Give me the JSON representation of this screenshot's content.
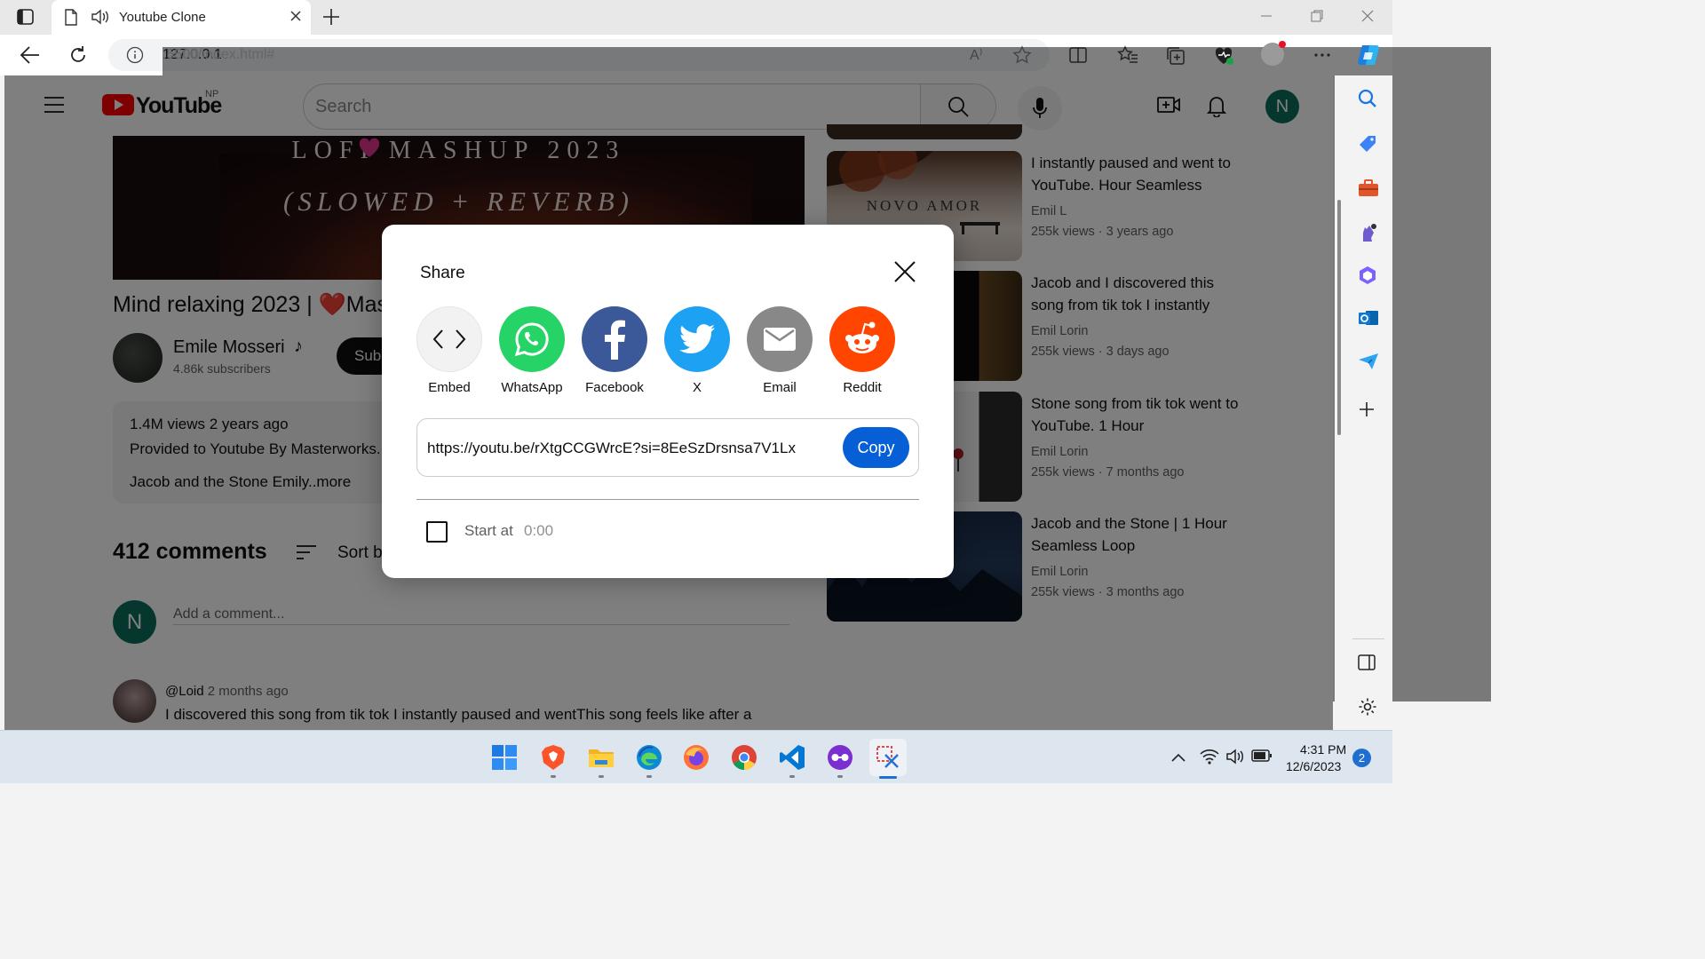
{
  "browser": {
    "tab_title": "Youtube Clone",
    "url_host": "127.0.0.1",
    "url_rest": ":5500/index.html#",
    "read_aloud": "A⁾"
  },
  "header": {
    "logo_text": "YouTube",
    "region": "NP",
    "search_placeholder": "Search",
    "avatar_letter": "N"
  },
  "video": {
    "thumb_line1": "LOFI    MASHUP 2023",
    "thumb_line2": "(SLOWED + REVERB)",
    "title_before": "Mind relaxing 2023 | ",
    "title_heart": "❤️",
    "title_after": "Mas",
    "channel": "Emile Mosseri",
    "channel_note": "♪",
    "subscribers": "4.86k subscribers",
    "subscribe_label": "Sub",
    "views_line": "1.4M views 2 years ago",
    "desc_line": "Provided to Youtube By Masterworks.",
    "desc_more": "Jacob and the Stone Emily..more"
  },
  "comments": {
    "count_label": "412 comments",
    "sort_label": "Sort b",
    "me_avatar": "N",
    "input_placeholder": "Add a comment...",
    "items": [
      {
        "handle": "@Loid",
        "time": "2 months ago",
        "text": "I discovered this song from tik tok I instantly paused and wentThis song feels like after a"
      }
    ]
  },
  "recommendations": [
    {
      "title": "I instantly paused and went to YouTube. Hour Seamless",
      "channel": "Emil L",
      "meta": "255k views · 3 years ago",
      "thumb_text": "NOVO AMOR"
    },
    {
      "title": "Jacob and I discovered this song from tik tok I instantly",
      "channel": "Emil Lorin",
      "meta": "255k views · 3 days ago",
      "thumb_text": ""
    },
    {
      "title": "Stone song from tik tok went to YouTube. 1 Hour",
      "channel": "Emil Lorin",
      "meta": "255k views · 7 months ago",
      "thumb_text": ""
    },
    {
      "title": "Jacob and the Stone | 1 Hour Seamless Loop",
      "channel": "Emil Lorin",
      "meta": "255k views · 3 months ago",
      "thumb_text": ""
    }
  ],
  "share_dialog": {
    "title": "Share",
    "targets": [
      {
        "label": "Embed",
        "icon": "embed-icon",
        "color": "#f2f2f2"
      },
      {
        "label": "WhatsApp",
        "icon": "whatsapp-icon",
        "color": "#25d366"
      },
      {
        "label": "Facebook",
        "icon": "facebook-icon",
        "color": "#3b5998"
      },
      {
        "label": "X",
        "icon": "twitter-icon",
        "color": "#1da1f2"
      },
      {
        "label": "Email",
        "icon": "email-icon",
        "color": "#888888"
      },
      {
        "label": "Reddit",
        "icon": "reddit-icon",
        "color": "#ff4500"
      }
    ],
    "link": "https://youtu.be/rXtgCCGWrcE?si=8EeSzDrsnsa7V1Lx",
    "copy_label": "Copy",
    "start_label": "Start at",
    "start_time": "0:00"
  },
  "taskbar": {
    "time": "4:31 PM",
    "date": "12/6/2023",
    "notifications": "2"
  },
  "colors": {
    "yt_red": "#ff0000",
    "copy_blue": "#065fd4",
    "avatar_teal": "#0b6e5f"
  }
}
